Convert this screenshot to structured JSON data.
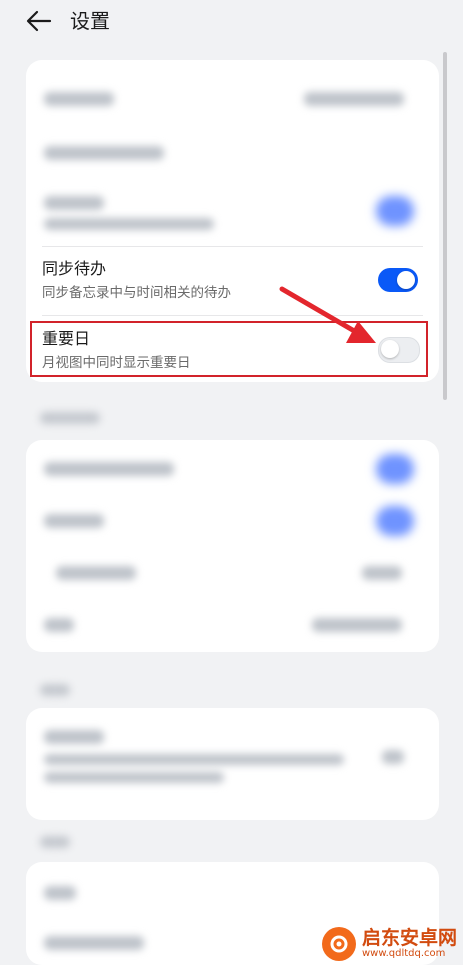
{
  "header": {
    "title": "设置"
  },
  "settings": {
    "sync_todo": {
      "title": "同步待办",
      "subtitle": "同步备忘录中与时间相关的待办",
      "enabled": true
    },
    "important_day": {
      "title": "重要日",
      "subtitle": "月视图中同时显示重要日",
      "enabled": false
    }
  },
  "watermark": {
    "name": "启东安卓网",
    "url": "www.qdltdq.com"
  },
  "colors": {
    "accent": "#0a59f7",
    "highlight": "#d2232a",
    "arrow": "#e3262d",
    "watermark": "#d24b0f"
  },
  "icons": {
    "back": "arrow-left-icon",
    "annotation": "red-arrow-icon"
  }
}
